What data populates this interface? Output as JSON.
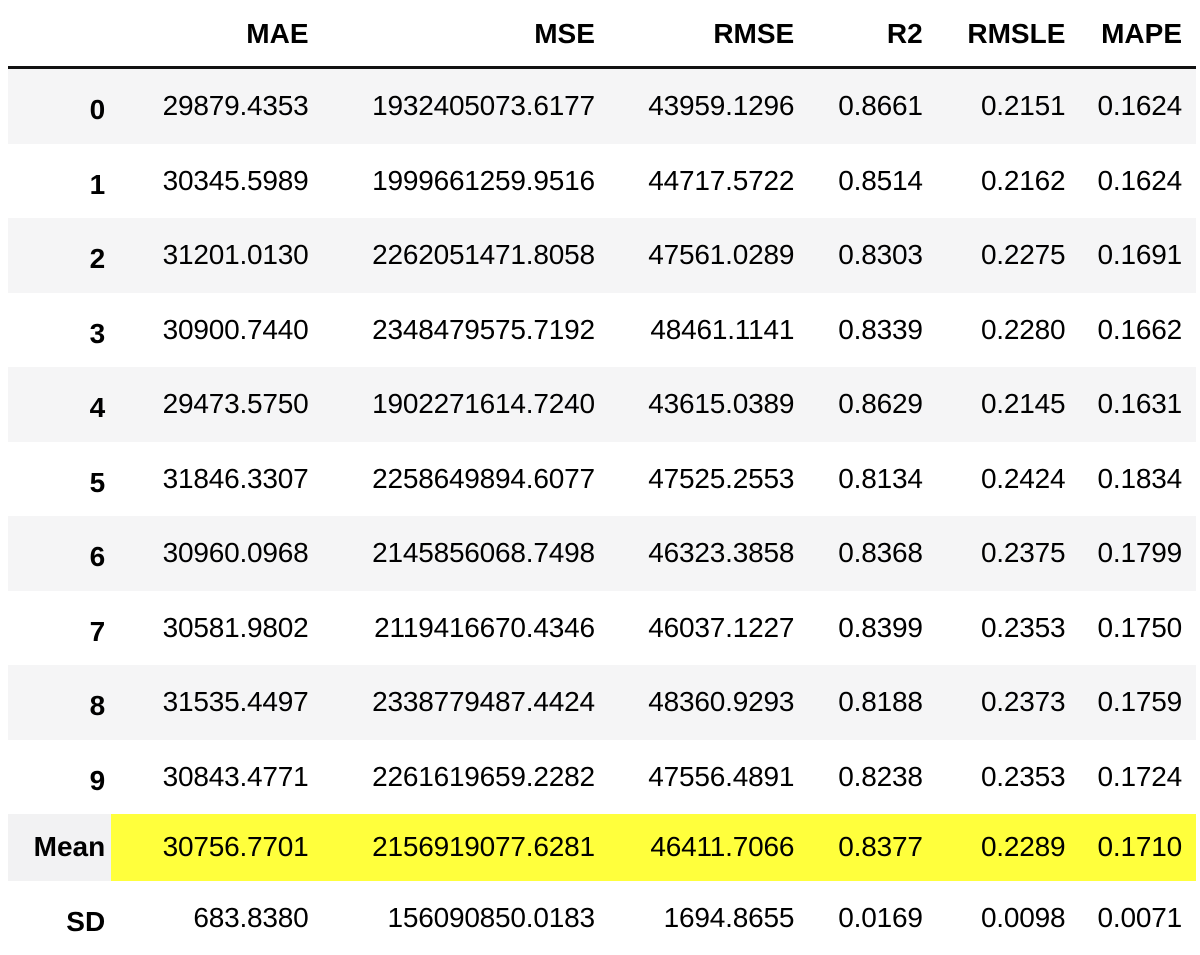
{
  "table": {
    "columns": [
      "",
      "MAE",
      "MSE",
      "RMSE",
      "R2",
      "RMSLE",
      "MAPE"
    ],
    "rows": [
      {
        "index": "0",
        "values": [
          "29879.4353",
          "1932405073.6177",
          "43959.1296",
          "0.8661",
          "0.2151",
          "0.1624"
        ],
        "style": "striped"
      },
      {
        "index": "1",
        "values": [
          "30345.5989",
          "1999661259.9516",
          "44717.5722",
          "0.8514",
          "0.2162",
          "0.1624"
        ],
        "style": "plain"
      },
      {
        "index": "2",
        "values": [
          "31201.0130",
          "2262051471.8058",
          "47561.0289",
          "0.8303",
          "0.2275",
          "0.1691"
        ],
        "style": "striped"
      },
      {
        "index": "3",
        "values": [
          "30900.7440",
          "2348479575.7192",
          "48461.1141",
          "0.8339",
          "0.2280",
          "0.1662"
        ],
        "style": "plain"
      },
      {
        "index": "4",
        "values": [
          "29473.5750",
          "1902271614.7240",
          "43615.0389",
          "0.8629",
          "0.2145",
          "0.1631"
        ],
        "style": "striped"
      },
      {
        "index": "5",
        "values": [
          "31846.3307",
          "2258649894.6077",
          "47525.2553",
          "0.8134",
          "0.2424",
          "0.1834"
        ],
        "style": "plain"
      },
      {
        "index": "6",
        "values": [
          "30960.0968",
          "2145856068.7498",
          "46323.3858",
          "0.8368",
          "0.2375",
          "0.1799"
        ],
        "style": "striped"
      },
      {
        "index": "7",
        "values": [
          "30581.9802",
          "2119416670.4346",
          "46037.1227",
          "0.8399",
          "0.2353",
          "0.1750"
        ],
        "style": "plain"
      },
      {
        "index": "8",
        "values": [
          "31535.4497",
          "2338779487.4424",
          "48360.9293",
          "0.8188",
          "0.2373",
          "0.1759"
        ],
        "style": "striped"
      },
      {
        "index": "9",
        "values": [
          "30843.4771",
          "2261619659.2282",
          "47556.4891",
          "0.8238",
          "0.2353",
          "0.1724"
        ],
        "style": "plain"
      },
      {
        "index": "Mean",
        "values": [
          "30756.7701",
          "2156919077.6281",
          "46411.7066",
          "0.8377",
          "0.2289",
          "0.1710"
        ],
        "style": "highlight"
      },
      {
        "index": "SD",
        "values": [
          "683.8380",
          "156090850.0183",
          "1694.8655",
          "0.0169",
          "0.0098",
          "0.0071"
        ],
        "style": "plain"
      }
    ]
  },
  "colors": {
    "highlight": "#ffff3c",
    "stripe": "#f5f5f6",
    "header_rule": "#111111"
  }
}
